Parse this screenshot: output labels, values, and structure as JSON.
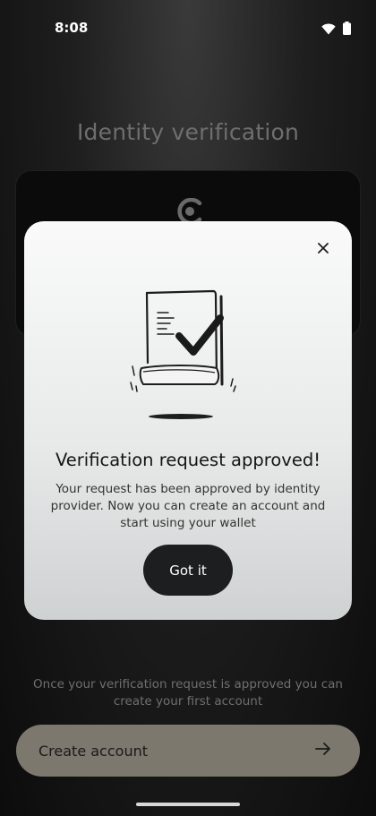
{
  "status_bar": {
    "time": "8:08",
    "icons": [
      "wifi-icon",
      "battery-icon"
    ]
  },
  "screen": {
    "title": "Identity verification",
    "bottom_hint": "Once your verification request is approved you can create your first account",
    "create_button_label": "Create account",
    "create_button_icon": "arrow-right-icon",
    "card_icon": "concordium-logo-icon"
  },
  "modal": {
    "title": "Verification request approved!",
    "body": "Your request has been approved by identity provider. Now you can create an account and start using your wallet",
    "button_label": "Got it",
    "close_icon": "close-icon",
    "illustration": "approved-document-illustration"
  },
  "colors": {
    "background": "#0c0c0c",
    "create_button": "#7d786e",
    "modal_button": "#1c1e1f",
    "title_text": "#6e6e6e"
  }
}
